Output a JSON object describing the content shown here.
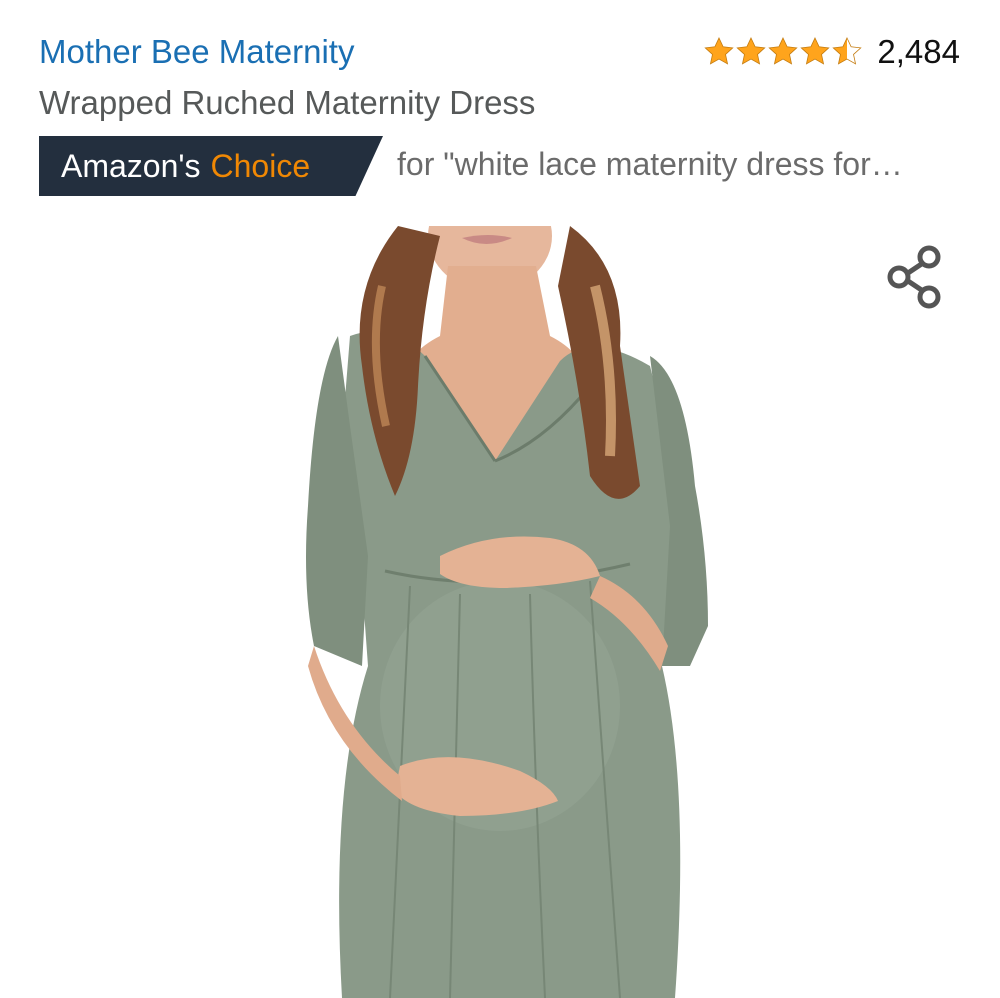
{
  "product": {
    "brand": "Mother Bee Maternity",
    "title": "Wrapped Ruched Maternity Dress",
    "rating": 4.5,
    "review_count": "2,484"
  },
  "badge": {
    "label_part1": "Amazon's",
    "label_part2": "Choice",
    "query": "for \"white lace maternity dress for…"
  },
  "icons": {
    "share": "share-icon",
    "star": "star-icon"
  },
  "colors": {
    "brand_link": "#1a6fb3",
    "badge_bg": "#232f3e",
    "badge_accent": "#f08804",
    "star": "#ffa41c",
    "title": "#565959"
  }
}
